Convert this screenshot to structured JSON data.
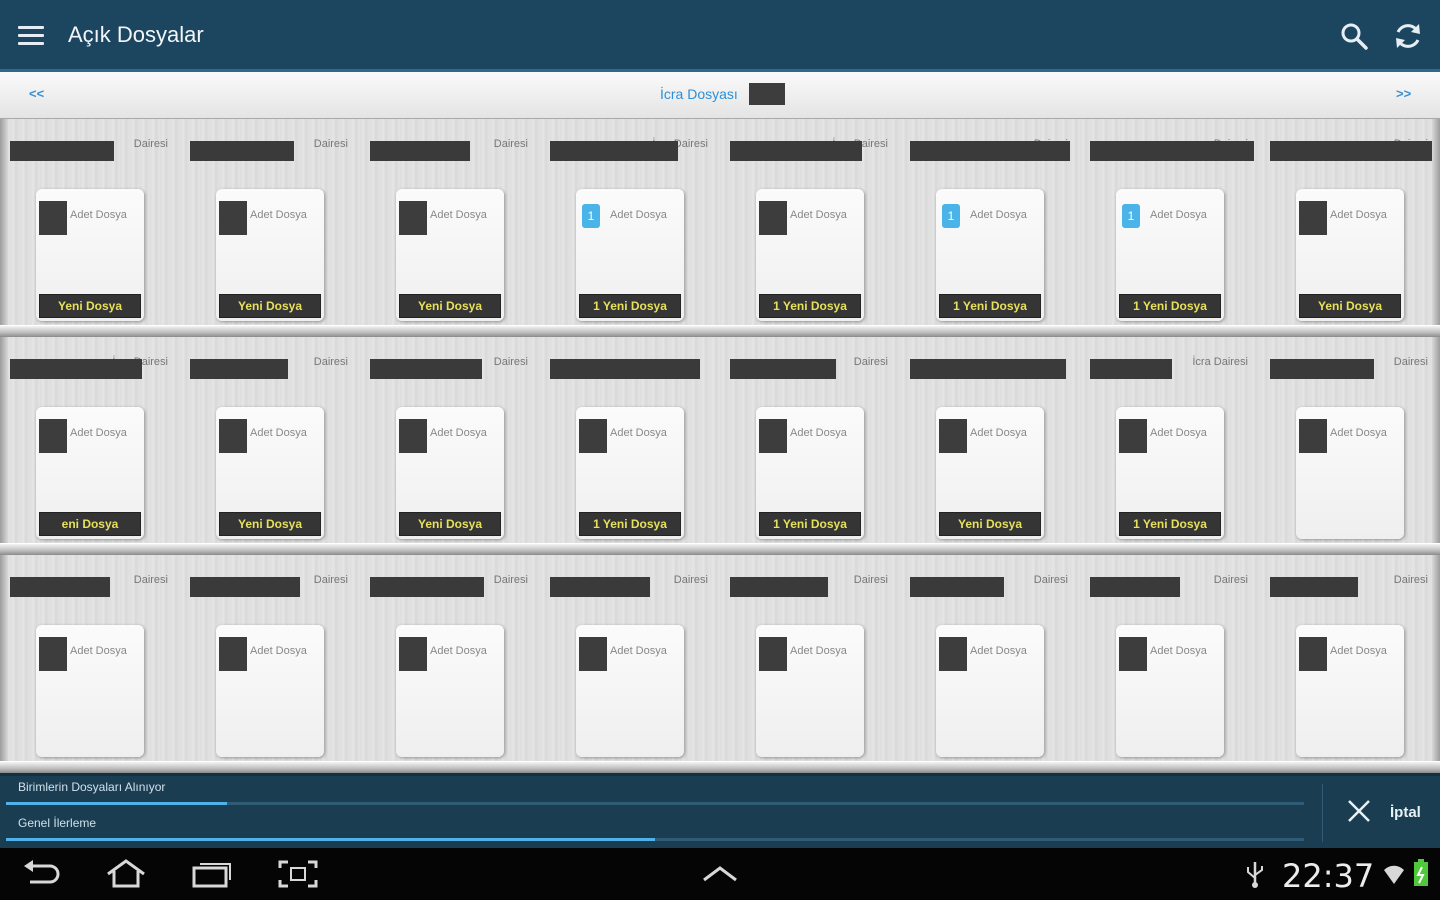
{
  "app": {
    "title": "Açık Dosyalar"
  },
  "tabstrip": {
    "prev": "<<",
    "title": "İcra Dosyası",
    "next": ">>"
  },
  "shelves": [
    {
      "slots": [
        {
          "label": "Dairesi",
          "count": null,
          "count_text": "Adet Dosya",
          "button": "Yeni Dosya",
          "redact_w": 104
        },
        {
          "label": "Dairesi",
          "count": null,
          "count_text": "Adet Dosya",
          "button": "Yeni Dosya",
          "redact_w": 104
        },
        {
          "label": "Dairesi",
          "count": null,
          "count_text": "Adet Dosya",
          "button": "Yeni Dosya",
          "redact_w": 100
        },
        {
          "label": "İcra Dairesi",
          "count": "1",
          "count_text": "Adet Dosya",
          "button": "1 Yeni Dosya",
          "redact_w": 128
        },
        {
          "label": "İcra Dairesi",
          "count": null,
          "count_text": "Adet Dosya",
          "button": "1 Yeni Dosya",
          "redact_w": 132
        },
        {
          "label": "Dairesi",
          "count": "1",
          "count_text": "Adet Dosya",
          "button": "1 Yeni Dosya",
          "redact_w": 160
        },
        {
          "label": "Dairesi",
          "count": "1",
          "count_text": "Adet Dosya",
          "button": "1 Yeni Dosya",
          "redact_w": 164
        },
        {
          "label": "Dairesi",
          "count": null,
          "count_text": "Adet Dosya",
          "button": "Yeni Dosya",
          "redact_w": 162
        }
      ]
    },
    {
      "slots": [
        {
          "label": "İcra Dairesi",
          "count": null,
          "count_text": "Adet Dosya",
          "button": "eni Dosya",
          "redact_w": 132
        },
        {
          "label": "Dairesi",
          "count": null,
          "count_text": "Adet Dosya",
          "button": "Yeni Dosya",
          "redact_w": 98
        },
        {
          "label": "Dairesi",
          "count": null,
          "count_text": "Adet Dosya",
          "button": "Yeni Dosya",
          "redact_w": 112
        },
        {
          "label": "",
          "count": null,
          "count_text": "Adet Dosya",
          "button": "1 Yeni Dosya",
          "redact_w": 150
        },
        {
          "label": "Dairesi",
          "count": null,
          "count_text": "Adet Dosya",
          "button": "1 Yeni Dosya",
          "redact_w": 106
        },
        {
          "label": "",
          "count": null,
          "count_text": "Adet Dosya",
          "button": "Yeni Dosya",
          "redact_w": 156
        },
        {
          "label": "İcra Dairesi",
          "count": null,
          "count_text": "Adet Dosya",
          "button": "1 Yeni Dosya",
          "redact_w": 82
        },
        {
          "label": "Dairesi",
          "count": null,
          "count_text": "Adet Dosya",
          "button": "",
          "redact_w": 104
        }
      ]
    },
    {
      "slots": [
        {
          "label": "Dairesi",
          "count": null,
          "count_text": "Adet Dosya",
          "button": "",
          "redact_w": 100
        },
        {
          "label": "Dairesi",
          "count": null,
          "count_text": "Adet Dosya",
          "button": "",
          "redact_w": 110
        },
        {
          "label": "Dairesi",
          "count": null,
          "count_text": "Adet Dosya",
          "button": "",
          "redact_w": 114
        },
        {
          "label": "Dairesi",
          "count": null,
          "count_text": "Adet Dosya",
          "button": "",
          "redact_w": 100
        },
        {
          "label": "Dairesi",
          "count": null,
          "count_text": "Adet Dosya",
          "button": "",
          "redact_w": 98
        },
        {
          "label": "Dairesi",
          "count": null,
          "count_text": "Adet Dosya",
          "button": "",
          "redact_w": 94
        },
        {
          "label": "Dairesi",
          "count": null,
          "count_text": "Adet Dosya",
          "button": "",
          "redact_w": 90
        },
        {
          "label": "Dairesi",
          "count": null,
          "count_text": "Adet Dosya",
          "button": "",
          "redact_w": 88
        }
      ]
    }
  ],
  "status": {
    "line1": "Birimlerin Dosyaları Alınıyor",
    "progress1": 0.17,
    "line2": "Genel İlerleme",
    "progress2": 0.5,
    "cancel": "İptal"
  },
  "system": {
    "clock": "22:37"
  },
  "colors": {
    "actionbar": "#1c4660",
    "accent": "#2d8fd8",
    "badge": "#4ab3e8",
    "button_text": "#e7e05a"
  }
}
